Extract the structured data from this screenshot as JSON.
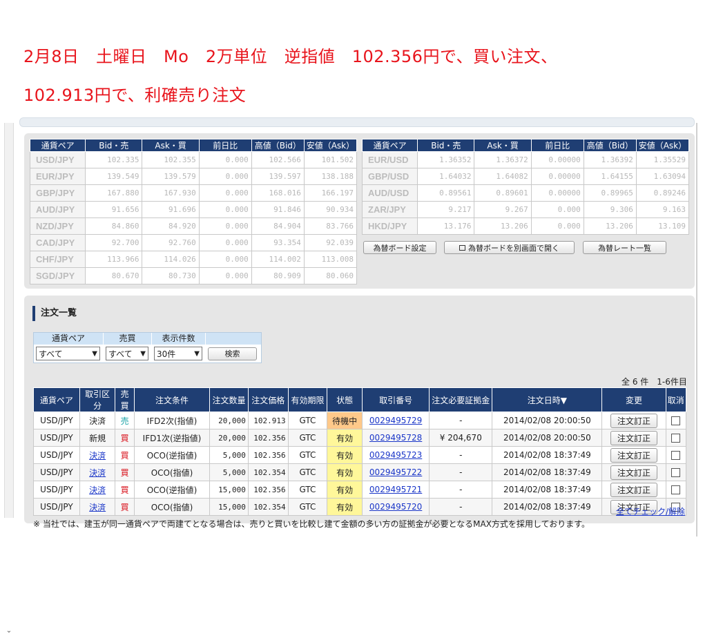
{
  "headline": {
    "line1": "2月8日　土曜日　Mo　2万単位　逆指値　102.356円で、買い注文、",
    "line2": "102.913円で、利確売り注文"
  },
  "rates": {
    "headers": [
      "通貨ペア",
      "Bid・売",
      "Ask・買",
      "前日比",
      "高値（Bid）",
      "安値（Ask）"
    ],
    "left": [
      {
        "pair": "USD/JPY",
        "bid": "102.335",
        "ask": "102.355",
        "change": "0.000",
        "high": "102.566",
        "low": "101.502"
      },
      {
        "pair": "EUR/JPY",
        "bid": "139.549",
        "ask": "139.579",
        "change": "0.000",
        "high": "139.597",
        "low": "138.188"
      },
      {
        "pair": "GBP/JPY",
        "bid": "167.880",
        "ask": "167.930",
        "change": "0.000",
        "high": "168.016",
        "low": "166.197"
      },
      {
        "pair": "AUD/JPY",
        "bid": "91.656",
        "ask": "91.696",
        "change": "0.000",
        "high": "91.846",
        "low": "90.934"
      },
      {
        "pair": "NZD/JPY",
        "bid": "84.860",
        "ask": "84.920",
        "change": "0.000",
        "high": "84.904",
        "low": "83.766"
      },
      {
        "pair": "CAD/JPY",
        "bid": "92.700",
        "ask": "92.760",
        "change": "0.000",
        "high": "93.354",
        "low": "92.039"
      },
      {
        "pair": "CHF/JPY",
        "bid": "113.966",
        "ask": "114.026",
        "change": "0.000",
        "high": "114.002",
        "low": "113.008"
      },
      {
        "pair": "SGD/JPY",
        "bid": "80.670",
        "ask": "80.730",
        "change": "0.000",
        "high": "80.909",
        "low": "80.060"
      }
    ],
    "right": [
      {
        "pair": "EUR/USD",
        "bid": "1.36352",
        "ask": "1.36372",
        "change": "0.00000",
        "high": "1.36392",
        "low": "1.35529"
      },
      {
        "pair": "GBP/USD",
        "bid": "1.64032",
        "ask": "1.64082",
        "change": "0.00000",
        "high": "1.64155",
        "low": "1.63094"
      },
      {
        "pair": "AUD/USD",
        "bid": "0.89561",
        "ask": "0.89601",
        "change": "0.00000",
        "high": "0.89965",
        "low": "0.89246"
      },
      {
        "pair": "ZAR/JPY",
        "bid": "9.217",
        "ask": "9.267",
        "change": "0.000",
        "high": "9.306",
        "low": "9.163"
      },
      {
        "pair": "HKD/JPY",
        "bid": "13.176",
        "ask": "13.206",
        "change": "0.000",
        "high": "13.206",
        "low": "13.109"
      }
    ],
    "buttons": {
      "settings": "為替ボード設定",
      "open_new": "為替ボードを別画面で開く",
      "list": "為替レート一覧"
    }
  },
  "orders": {
    "title": "注文一覧",
    "filter": {
      "headers": [
        "通貨ペア",
        "売買",
        "表示件数"
      ],
      "pair_value": "すべて",
      "side_value": "すべて",
      "count_value": "30件",
      "search_label": "検索"
    },
    "count_text": "全 6 件　1-6件目",
    "headers": [
      "通貨ペア",
      "取引区分",
      "売買",
      "注文条件",
      "注文数量",
      "注文価格",
      "有効期限",
      "状態",
      "取引番号",
      "注文必要証拠金",
      "注文日時▼",
      "変更",
      "取消"
    ],
    "rows": [
      {
        "pair": "USD/JPY",
        "type": "決済",
        "type_link": false,
        "side": "売",
        "side_kind": "sell",
        "cond": "IFD2次(指値)",
        "qty": "20,000",
        "price": "102.913",
        "expiry": "GTC",
        "status": "待機中",
        "status_kind": "wait",
        "id": "0029495729",
        "margin": "-",
        "datetime": "2014/02/08 20:00:50",
        "edit": "注文訂正"
      },
      {
        "pair": "USD/JPY",
        "type": "新規",
        "type_link": false,
        "side": "買",
        "side_kind": "buy",
        "cond": "IFD1次(逆指値)",
        "qty": "20,000",
        "price": "102.356",
        "expiry": "GTC",
        "status": "有効",
        "status_kind": "ok",
        "id": "0029495728",
        "margin": "¥ 204,670",
        "datetime": "2014/02/08 20:00:50",
        "edit": "注文訂正"
      },
      {
        "pair": "USD/JPY",
        "type": "決済",
        "type_link": true,
        "side": "買",
        "side_kind": "buy",
        "cond": "OCO(逆指値)",
        "qty": "5,000",
        "price": "102.356",
        "expiry": "GTC",
        "status": "有効",
        "status_kind": "ok",
        "id": "0029495723",
        "margin": "-",
        "datetime": "2014/02/08 18:37:49",
        "edit": "注文訂正"
      },
      {
        "pair": "USD/JPY",
        "type": "決済",
        "type_link": true,
        "side": "買",
        "side_kind": "buy",
        "cond": "OCO(指値)",
        "qty": "5,000",
        "price": "102.354",
        "expiry": "GTC",
        "status": "有効",
        "status_kind": "ok",
        "id": "0029495722",
        "margin": "-",
        "datetime": "2014/02/08 18:37:49",
        "edit": "注文訂正"
      },
      {
        "pair": "USD/JPY",
        "type": "決済",
        "type_link": true,
        "side": "買",
        "side_kind": "buy",
        "cond": "OCO(逆指値)",
        "qty": "15,000",
        "price": "102.356",
        "expiry": "GTC",
        "status": "有効",
        "status_kind": "ok",
        "id": "0029495721",
        "margin": "-",
        "datetime": "2014/02/08 18:37:49",
        "edit": "注文訂正"
      },
      {
        "pair": "USD/JPY",
        "type": "決済",
        "type_link": true,
        "side": "買",
        "side_kind": "buy",
        "cond": "OCO(指値)",
        "qty": "15,000",
        "price": "102.354",
        "expiry": "GTC",
        "status": "有効",
        "status_kind": "ok",
        "id": "0029495720",
        "margin": "-",
        "datetime": "2014/02/08 18:37:49",
        "edit": "注文訂正"
      }
    ],
    "check_all": "全てチェック/解除",
    "note": "※ 当社では、建玉が同一通貨ペアで両建てとなる場合は、売りと買いを比較し建て金額の多い方の証拠金が必要となるMAX方式を採用しております。"
  },
  "colors": {
    "header_navy": "#1f3e73",
    "headline_red": "#e8141c",
    "sell": "#17a2a6",
    "buy": "#d8101a",
    "status_wait": "#ffc98a",
    "status_ok": "#fff79a",
    "link": "#1a36c8"
  }
}
